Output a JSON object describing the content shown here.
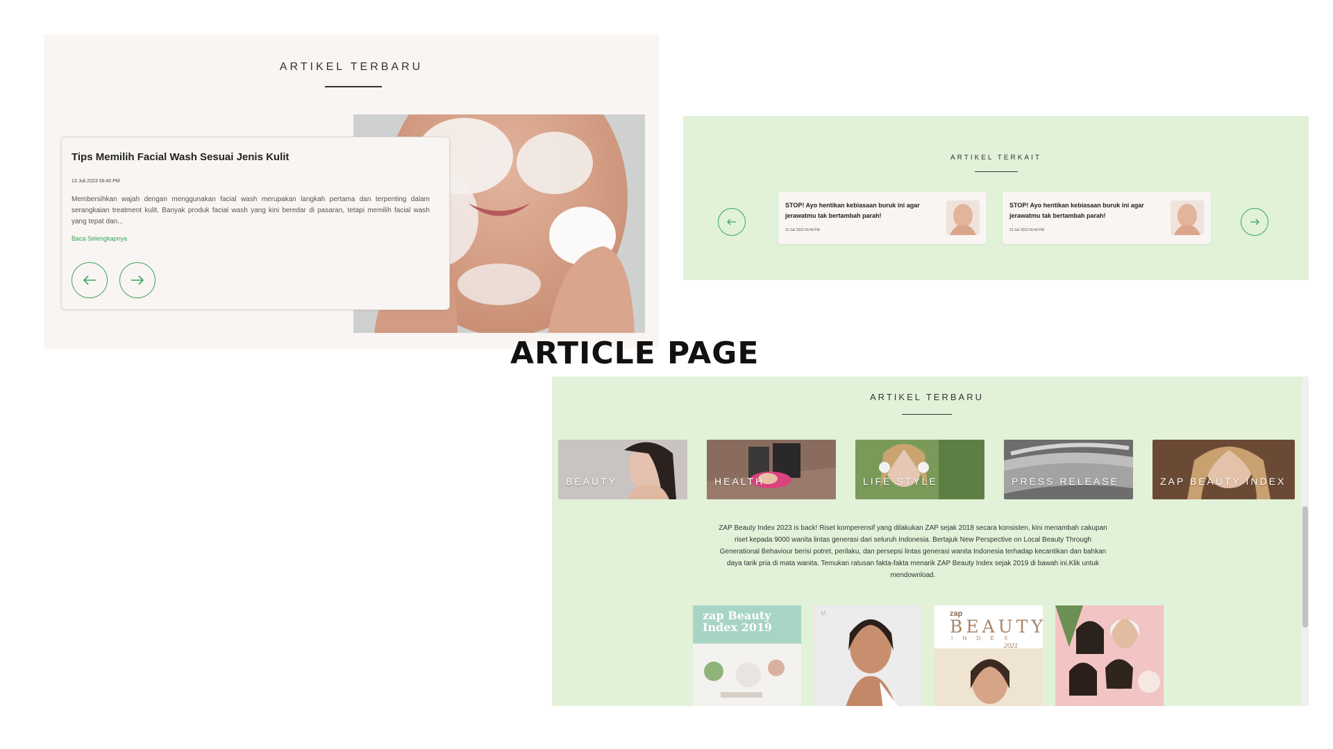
{
  "latest": {
    "section_title": "ARTIKEL TERBARU",
    "article": {
      "title": "Tips Memilih Facial Wash Sesuai Jenis Kulit",
      "date": "13 Juli 2023 06:40 PM",
      "excerpt": "Membersihkan wajah dengan menggunakan facial wash merupakan langkah pertama dan terpenting dalam serangkaian treatment kulit. Banyak produk facial wash yang kini beredar di pasaran, tetapi memilih facial wash yang tepat dan...",
      "read_more": "Baca Selengkapnya"
    },
    "prev_icon": "arrow-left-icon",
    "next_icon": "arrow-right-icon"
  },
  "related": {
    "section_title": "ARTIKEL TERKAIT",
    "cards": [
      {
        "title": "STOP! Ayo hentikan kebiasaan buruk ini agar jerawatmu tak bertambah parah!",
        "date": "13 Juli 2023 06:40 PM"
      },
      {
        "title": "STOP! Ayo hentikan kebiasaan buruk ini agar jerawatmu tak bertambah parah!",
        "date": "13 Juli 2023 06:40 PM"
      }
    ]
  },
  "heading": "ARTICLE PAGE",
  "categories_section": {
    "section_title": "ARTIKEL TERBARU",
    "categories": [
      "BEAUTY",
      "HEALTH",
      "LIFE STYLE",
      "PRESS RELEASE",
      "ZAP BEAUTY INDEX"
    ],
    "description": "ZAP Beauty Index 2023 is back! Riset komperensif yang dilakukan ZAP sejak 2018 secara konsisten, kini menambah cakupan riset kepada 9000 wanita lintas generasi dari seluruh Indonesia. Bertajuk New Perspective on Local Beauty Through Generational Behaviour berisi potret, perilaku, dan persepsi lintas generasi wanita Indonesia terhadap kecantikan dan bahkan daya tarik pria di mata wanita. Temukan ratusan fakta-fakta menarik ZAP Beauty Index sejak 2019 di bawah ini.Klik untuk mendownload.",
    "covers": [
      {
        "text": "zap Beauty Index 2019"
      },
      {
        "text": "M"
      },
      {
        "text": "zap",
        "title": "BEAUTY",
        "sub": "I N D E X",
        "year": "2021"
      },
      {
        "text": ""
      }
    ]
  },
  "colors": {
    "accent": "#3aa35f",
    "beige": "#f9f5f2",
    "green_bg": "#e1f2d8"
  }
}
